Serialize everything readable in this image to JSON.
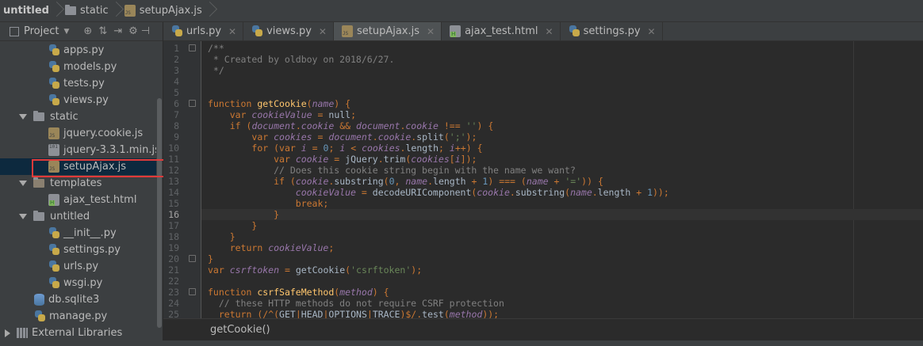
{
  "breadcrumb": {
    "project": "untitled",
    "folder": "static",
    "file": "setupAjax.js"
  },
  "project_panel": {
    "title": "Project",
    "tree": [
      {
        "label": "apps.py",
        "icon": "python-file-icon",
        "depth": 3
      },
      {
        "label": "models.py",
        "icon": "python-file-icon",
        "depth": 3
      },
      {
        "label": "tests.py",
        "icon": "python-file-icon",
        "depth": 3
      },
      {
        "label": "views.py",
        "icon": "python-file-icon",
        "depth": 3
      },
      {
        "label": "static",
        "icon": "folder-icon",
        "depth": 1,
        "expanded": true
      },
      {
        "label": "jquery.cookie.js",
        "icon": "js-file-icon",
        "depth": 3
      },
      {
        "label": "jquery-3.3.1.min.js",
        "icon": "text-file-icon",
        "depth": 3
      },
      {
        "label": "setupAjax.js",
        "icon": "js-file-icon",
        "depth": 3,
        "selected": true
      },
      {
        "label": "templates",
        "icon": "folder-icon",
        "depth": 1,
        "expanded": true
      },
      {
        "label": "ajax_test.html",
        "icon": "html-file-icon",
        "depth": 3
      },
      {
        "label": "untitled",
        "icon": "folder-icon",
        "depth": 1,
        "expanded": true
      },
      {
        "label": "__init__.py",
        "icon": "python-file-icon",
        "depth": 3
      },
      {
        "label": "settings.py",
        "icon": "python-file-icon",
        "depth": 3
      },
      {
        "label": "urls.py",
        "icon": "python-file-icon",
        "depth": 3
      },
      {
        "label": "wsgi.py",
        "icon": "python-file-icon",
        "depth": 3
      },
      {
        "label": "db.sqlite3",
        "icon": "database-icon",
        "depth": 2
      },
      {
        "label": "manage.py",
        "icon": "python-file-icon",
        "depth": 2
      },
      {
        "label": "External Libraries",
        "icon": "library-icon",
        "depth": 0,
        "expanded": false
      }
    ]
  },
  "tabs": [
    {
      "label": "urls.py",
      "icon": "python-file-icon"
    },
    {
      "label": "views.py",
      "icon": "python-file-icon"
    },
    {
      "label": "setupAjax.js",
      "icon": "js-file-icon",
      "active": true
    },
    {
      "label": "ajax_test.html",
      "icon": "html-file-icon"
    },
    {
      "label": "settings.py",
      "icon": "python-file-icon"
    }
  ],
  "editor": {
    "current_line": 16,
    "line_numbers": [
      "1",
      "2",
      "3",
      "4",
      "5",
      "6",
      "7",
      "8",
      "9",
      "10",
      "11",
      "12",
      "13",
      "14",
      "15",
      "16",
      "17",
      "18",
      "19",
      "20",
      "21",
      "22",
      "23",
      "24",
      "25"
    ],
    "lines": [
      "/**",
      " * Created by oldboy on 2018/6/27.",
      " */",
      "",
      "",
      "function getCookie(name) {",
      "    var cookieValue = null;",
      "    if (document.cookie && document.cookie !== '') {",
      "        var cookies = document.cookie.split(';');",
      "        for (var i = 0; i < cookies.length; i++) {",
      "            var cookie = jQuery.trim(cookies[i]);",
      "            // Does this cookie string begin with the name we want?",
      "            if (cookie.substring(0, name.length + 1) === (name + '=')) {",
      "                cookieValue = decodeURIComponent(cookie.substring(name.length + 1));",
      "                break;",
      "            }",
      "        }",
      "    }",
      "    return cookieValue;",
      "}",
      "var csrftoken = getCookie('csrftoken');",
      "",
      "function csrfSafeMethod(method) {",
      "  // these HTTP methods do not require CSRF protection",
      "  return (/^(GET|HEAD|OPTIONS|TRACE)$/.test(method));"
    ]
  },
  "code_breadcrumb": "getCookie()",
  "colors": {
    "editor_bg": "#2b2b2b",
    "panel_bg": "#3c3f41",
    "keyword": "#cc7832",
    "function": "#ffc66d",
    "comment": "#808080",
    "string": "#6a8759",
    "number": "#6897bb",
    "highlight_box": "#e03a3a"
  }
}
